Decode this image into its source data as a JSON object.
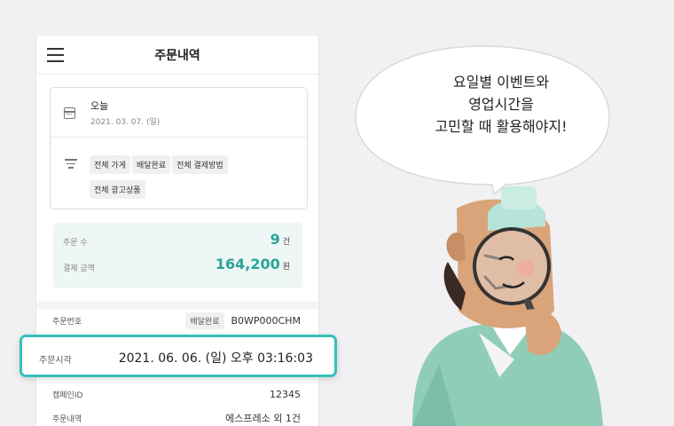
{
  "header": {
    "title": "주문내역",
    "menu_icon": "hamburger-menu-icon"
  },
  "date_filter": {
    "label": "오늘",
    "value": "2021. 03. 07. (일)",
    "icon": "calendar-icon"
  },
  "filters": {
    "icon": "filter-icon",
    "chips": [
      "전체 가게",
      "배달완료",
      "전체 결제방법",
      "전체 광고상품"
    ]
  },
  "summary": {
    "order_count_label": "주문 수",
    "order_count_value": "9",
    "order_count_unit": "건",
    "payment_label": "결제 금액",
    "payment_value": "164,200",
    "payment_unit": "원",
    "accent_color": "#2aa397"
  },
  "order": {
    "number_label": "주문번호",
    "status_badge": "배달완료",
    "number_value": "B0WP000CHM",
    "time_label": "주문시각",
    "time_value": "2021. 06. 06. (일) 오후 03:16:03",
    "campaign_label": "캠페인ID",
    "campaign_value": "12345",
    "detail_label": "주문내역",
    "detail_value": "에스프레소 외 1건"
  },
  "highlight_color": "#35c1bb",
  "speech": {
    "lines": [
      "요일별 이벤트와",
      "영업시간을",
      "고민할 때 활용해야지!"
    ]
  }
}
